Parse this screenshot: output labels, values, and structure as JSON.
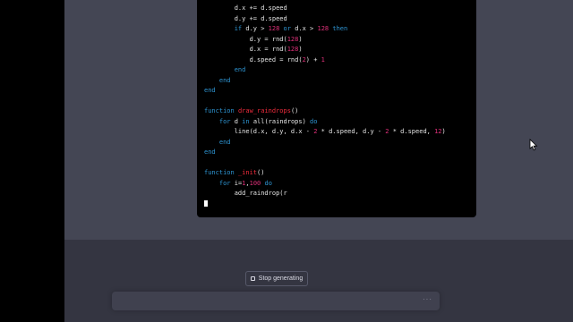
{
  "code": {
    "lines": [
      [
        {
          "t": "        d.x += d.speed",
          "c": "op"
        }
      ],
      [
        {
          "t": "        d.y += d.speed",
          "c": "op"
        }
      ],
      [
        {
          "t": "        ",
          "c": "op"
        },
        {
          "t": "if",
          "c": "kw"
        },
        {
          "t": " d.y > ",
          "c": "op"
        },
        {
          "t": "128",
          "c": "num"
        },
        {
          "t": " ",
          "c": "op"
        },
        {
          "t": "or",
          "c": "kw"
        },
        {
          "t": " d.x > ",
          "c": "op"
        },
        {
          "t": "128",
          "c": "num"
        },
        {
          "t": " ",
          "c": "op"
        },
        {
          "t": "then",
          "c": "kw"
        }
      ],
      [
        {
          "t": "            d.y = rnd(",
          "c": "op"
        },
        {
          "t": "128",
          "c": "num"
        },
        {
          "t": ")",
          "c": "op"
        }
      ],
      [
        {
          "t": "            d.x = rnd(",
          "c": "op"
        },
        {
          "t": "128",
          "c": "num"
        },
        {
          "t": ")",
          "c": "op"
        }
      ],
      [
        {
          "t": "            d.speed = rnd(",
          "c": "op"
        },
        {
          "t": "2",
          "c": "num"
        },
        {
          "t": ") + ",
          "c": "op"
        },
        {
          "t": "1",
          "c": "num"
        }
      ],
      [
        {
          "t": "        ",
          "c": "op"
        },
        {
          "t": "end",
          "c": "kw"
        }
      ],
      [
        {
          "t": "    ",
          "c": "op"
        },
        {
          "t": "end",
          "c": "kw"
        }
      ],
      [
        {
          "t": "end",
          "c": "kw"
        }
      ],
      [
        {
          "t": "",
          "c": "op"
        }
      ],
      [
        {
          "t": "function",
          "c": "kw"
        },
        {
          "t": " ",
          "c": "op"
        },
        {
          "t": "draw_raindrops",
          "c": "fn"
        },
        {
          "t": "()",
          "c": "op"
        }
      ],
      [
        {
          "t": "    ",
          "c": "op"
        },
        {
          "t": "for",
          "c": "kw"
        },
        {
          "t": " d ",
          "c": "op"
        },
        {
          "t": "in",
          "c": "kw"
        },
        {
          "t": " all(raindrops) ",
          "c": "op"
        },
        {
          "t": "do",
          "c": "kw"
        }
      ],
      [
        {
          "t": "        line(d.x, d.y, d.x - ",
          "c": "op"
        },
        {
          "t": "2",
          "c": "num"
        },
        {
          "t": " * d.speed, d.y - ",
          "c": "op"
        },
        {
          "t": "2",
          "c": "num"
        },
        {
          "t": " * d.speed, ",
          "c": "op"
        },
        {
          "t": "12",
          "c": "num"
        },
        {
          "t": ")",
          "c": "op"
        }
      ],
      [
        {
          "t": "    ",
          "c": "op"
        },
        {
          "t": "end",
          "c": "kw"
        }
      ],
      [
        {
          "t": "end",
          "c": "kw"
        }
      ],
      [
        {
          "t": "",
          "c": "op"
        }
      ],
      [
        {
          "t": "function",
          "c": "kw"
        },
        {
          "t": " ",
          "c": "op"
        },
        {
          "t": "_init",
          "c": "fn"
        },
        {
          "t": "()",
          "c": "op"
        }
      ],
      [
        {
          "t": "    ",
          "c": "op"
        },
        {
          "t": "for",
          "c": "kw"
        },
        {
          "t": " i=",
          "c": "op"
        },
        {
          "t": "1",
          "c": "num"
        },
        {
          "t": ",",
          "c": "op"
        },
        {
          "t": "100",
          "c": "num"
        },
        {
          "t": " ",
          "c": "op"
        },
        {
          "t": "do",
          "c": "kw"
        }
      ],
      [
        {
          "t": "        add_raindrop(r",
          "c": "op"
        }
      ],
      [
        {
          "t": "",
          "c": "op"
        }
      ]
    ]
  },
  "stop_button": {
    "label": "Stop generating"
  },
  "input": {
    "placeholder": ""
  },
  "colors": {
    "background": "#343541",
    "message_bg": "#444654",
    "code_bg": "#000000",
    "keyword": "#2e95d3",
    "function_name": "#f22c3d",
    "number": "#df3079"
  },
  "icons": {
    "stop": "stop-square-icon",
    "more": "dots-icon",
    "pointer": "mouse-pointer-icon"
  }
}
